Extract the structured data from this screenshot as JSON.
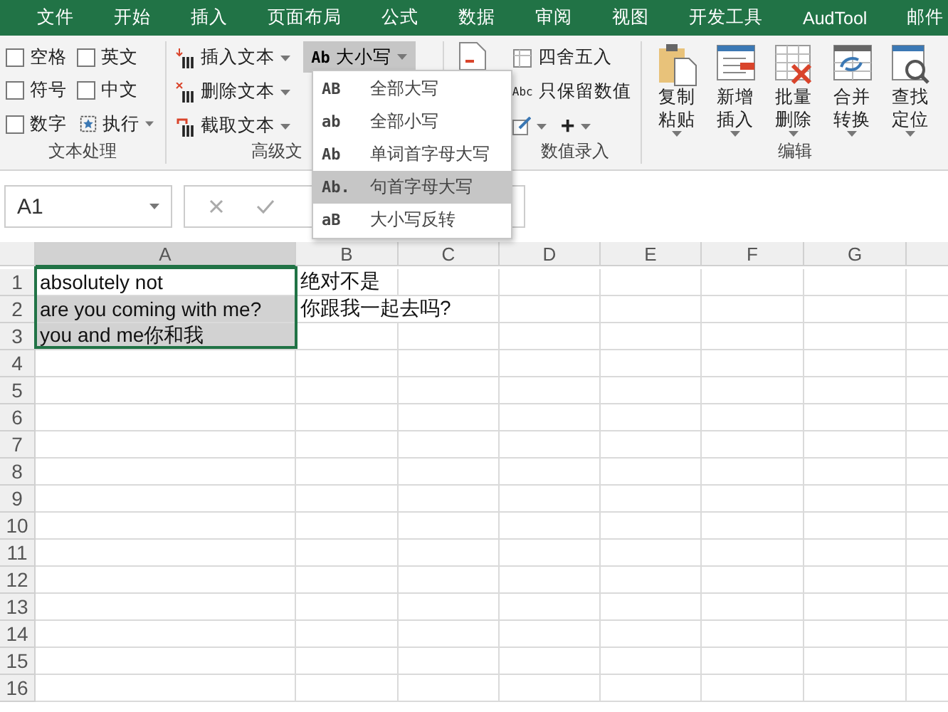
{
  "menu_tabs": [
    "文件",
    "开始",
    "插入",
    "页面布局",
    "公式",
    "数据",
    "审阅",
    "视图",
    "开发工具",
    "AudTool",
    "邮件"
  ],
  "ribbon": {
    "text_group": {
      "label": "文本处理",
      "checkboxes": [
        {
          "label": "空格",
          "checked": false
        },
        {
          "label": "英文",
          "checked": false
        },
        {
          "label": "符号",
          "checked": false
        },
        {
          "label": "中文",
          "checked": false
        },
        {
          "label": "数字",
          "checked": false
        }
      ],
      "run_button": "执行"
    },
    "advanced_group": {
      "label": "高级文",
      "buttons": [
        {
          "kind": "insert",
          "label": "插入文本"
        },
        {
          "kind": "delete",
          "label": "删除文本"
        },
        {
          "kind": "extract",
          "label": "截取文本"
        }
      ]
    },
    "case_button": {
      "code": "Ab",
      "label": "大小写",
      "expanded": true
    },
    "number_group": {
      "label": "数值录入",
      "buttons": [
        "四舍五入",
        "只保留数值"
      ],
      "abc_code": "Abc",
      "plus": "+"
    },
    "edit_group": {
      "label": "编辑",
      "buttons": [
        {
          "kind": "paste",
          "label": "复制粘贴"
        },
        {
          "kind": "insert",
          "label": "新增插入"
        },
        {
          "kind": "delete",
          "label": "批量删除"
        },
        {
          "kind": "convert",
          "label": "合并转换"
        },
        {
          "kind": "find",
          "label": "查找定位"
        }
      ]
    }
  },
  "case_menu": [
    {
      "code": "AB",
      "label": "全部大写",
      "selected": false
    },
    {
      "code": "ab",
      "label": "全部小写",
      "selected": false
    },
    {
      "code": "Ab",
      "label": "单词首字母大写",
      "selected": false
    },
    {
      "code": "Ab.",
      "label": "句首字母大写",
      "selected": true
    },
    {
      "code": "aB",
      "label": "大小写反转",
      "selected": false
    }
  ],
  "name_box": "A1",
  "columns": [
    {
      "label": "A",
      "selected": true
    },
    {
      "label": "B",
      "selected": false
    },
    {
      "label": "C",
      "selected": false
    },
    {
      "label": "D",
      "selected": false
    },
    {
      "label": "E",
      "selected": false
    },
    {
      "label": "F",
      "selected": false
    },
    {
      "label": "G",
      "selected": false
    }
  ],
  "rows": [
    {
      "number": "1",
      "cells": [
        "absolutely not",
        "绝对不是"
      ],
      "selected": false
    },
    {
      "number": "2",
      "cells": [
        "are you coming with me?",
        "你跟我一起去吗?"
      ],
      "selected": true
    },
    {
      "number": "3",
      "cells": [
        "you and me你和我"
      ],
      "selected": true
    },
    {
      "number": "4",
      "cells": [],
      "selected": false
    },
    {
      "number": "5",
      "cells": [],
      "selected": false
    },
    {
      "number": "6",
      "cells": [],
      "selected": false
    },
    {
      "number": "7",
      "cells": [],
      "selected": false
    },
    {
      "number": "8",
      "cells": [],
      "selected": false
    },
    {
      "number": "9",
      "cells": [],
      "selected": false
    },
    {
      "number": "10",
      "cells": [],
      "selected": false
    },
    {
      "number": "11",
      "cells": [],
      "selected": false
    },
    {
      "number": "12",
      "cells": [],
      "selected": false
    },
    {
      "number": "13",
      "cells": [],
      "selected": false
    },
    {
      "number": "14",
      "cells": [],
      "selected": false
    },
    {
      "number": "15",
      "cells": [],
      "selected": false
    },
    {
      "number": "16",
      "cells": [],
      "selected": false
    }
  ]
}
